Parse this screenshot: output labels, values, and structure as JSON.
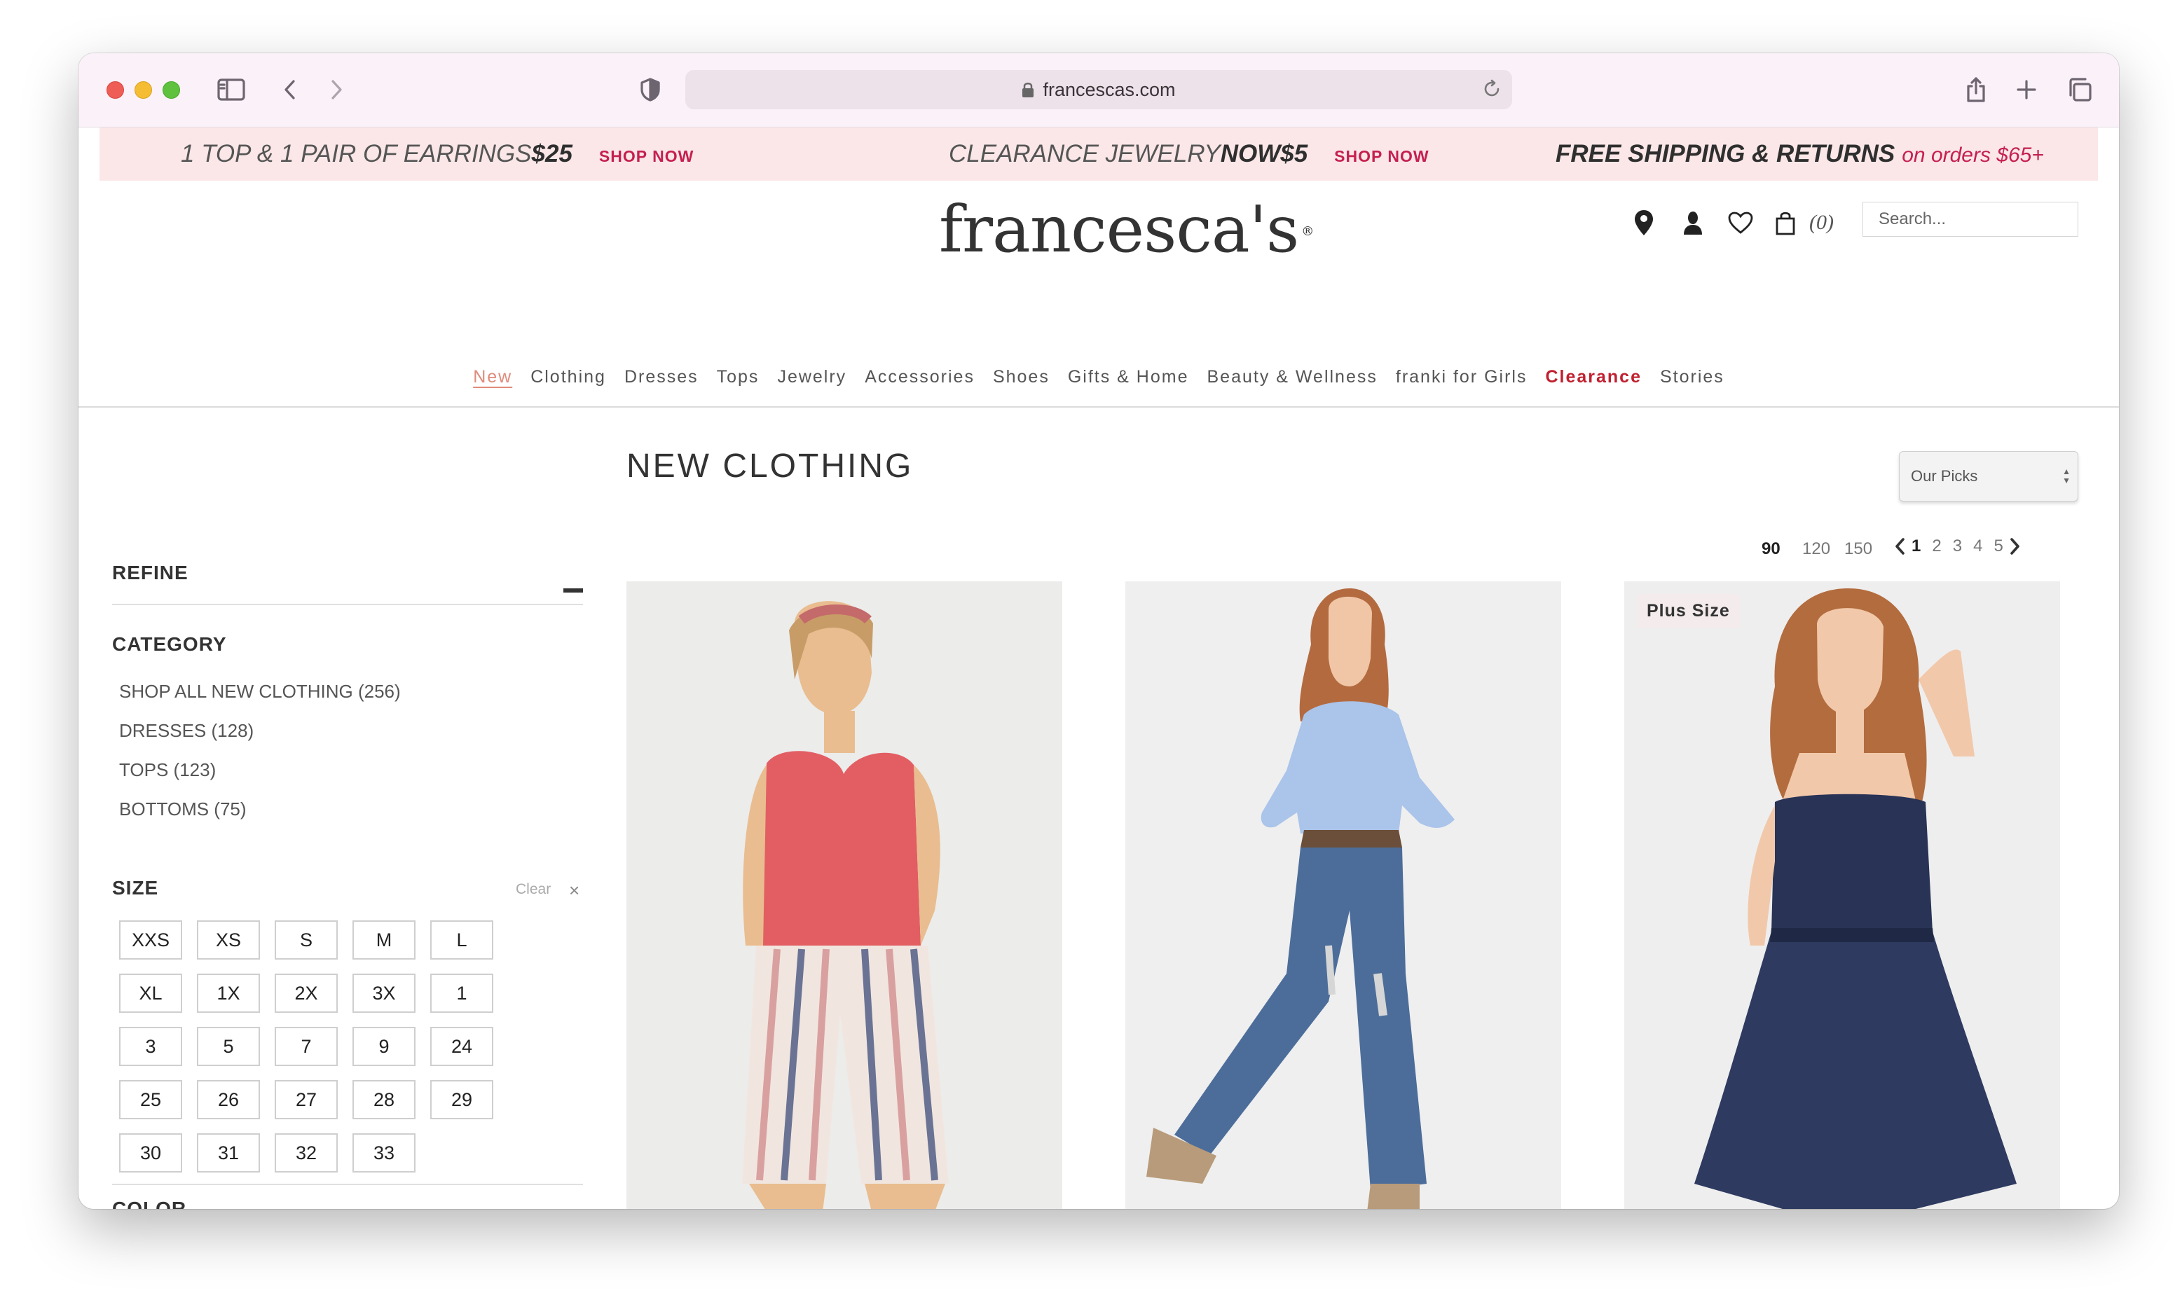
{
  "browser": {
    "url": "francescas.com"
  },
  "promo": {
    "offer1_text": "1 TOP & 1 PAIR OF EARRINGS ",
    "offer1_price": "$25",
    "offer1_cta": "SHOP NOW",
    "offer2_text": "CLEARANCE JEWELRY ",
    "offer2_bold": "NOW ",
    "offer2_price": "$5",
    "offer2_cta": "SHOP NOW",
    "offer3_bold": "FREE SHIPPING & RETURNS",
    "offer3_note": "on orders $65+"
  },
  "header": {
    "logo": "francesca's",
    "logo_mark": "®",
    "bag_count": "(0)",
    "search_placeholder": "Search..."
  },
  "nav": [
    "New",
    "Clothing",
    "Dresses",
    "Tops",
    "Jewelry",
    "Accessories",
    "Shoes",
    "Gifts & Home",
    "Beauty & Wellness",
    "franki for Girls",
    "Clearance",
    "Stories"
  ],
  "sidebar": {
    "refine_label": "REFINE",
    "category_label": "CATEGORY",
    "categories": [
      "SHOP ALL NEW CLOTHING (256)",
      "DRESSES (128)",
      "TOPS (123)",
      "BOTTOMS (75)"
    ],
    "size_label": "SIZE",
    "clear_label": "Clear",
    "sizes": [
      "XXS",
      "XS",
      "S",
      "M",
      "L",
      "XL",
      "1X",
      "2X",
      "3X",
      "1",
      "3",
      "5",
      "7",
      "9",
      "24",
      "25",
      "26",
      "27",
      "28",
      "29",
      "30",
      "31",
      "32",
      "33"
    ],
    "color_label": "COLOR"
  },
  "main": {
    "title": "NEW CLOTHING",
    "sort_value": "Our Picks",
    "per_page": [
      "90",
      "120",
      "150"
    ],
    "pages": [
      "1",
      "2",
      "3",
      "4",
      "5"
    ],
    "products": [
      {
        "badge": ""
      },
      {
        "badge": ""
      },
      {
        "badge": "Plus Size"
      }
    ]
  },
  "colors": {
    "accent": "#c5204f",
    "promo_bg": "#fbe7e8",
    "nav_active": "#e08b7b",
    "clearance": "#c0202f"
  }
}
